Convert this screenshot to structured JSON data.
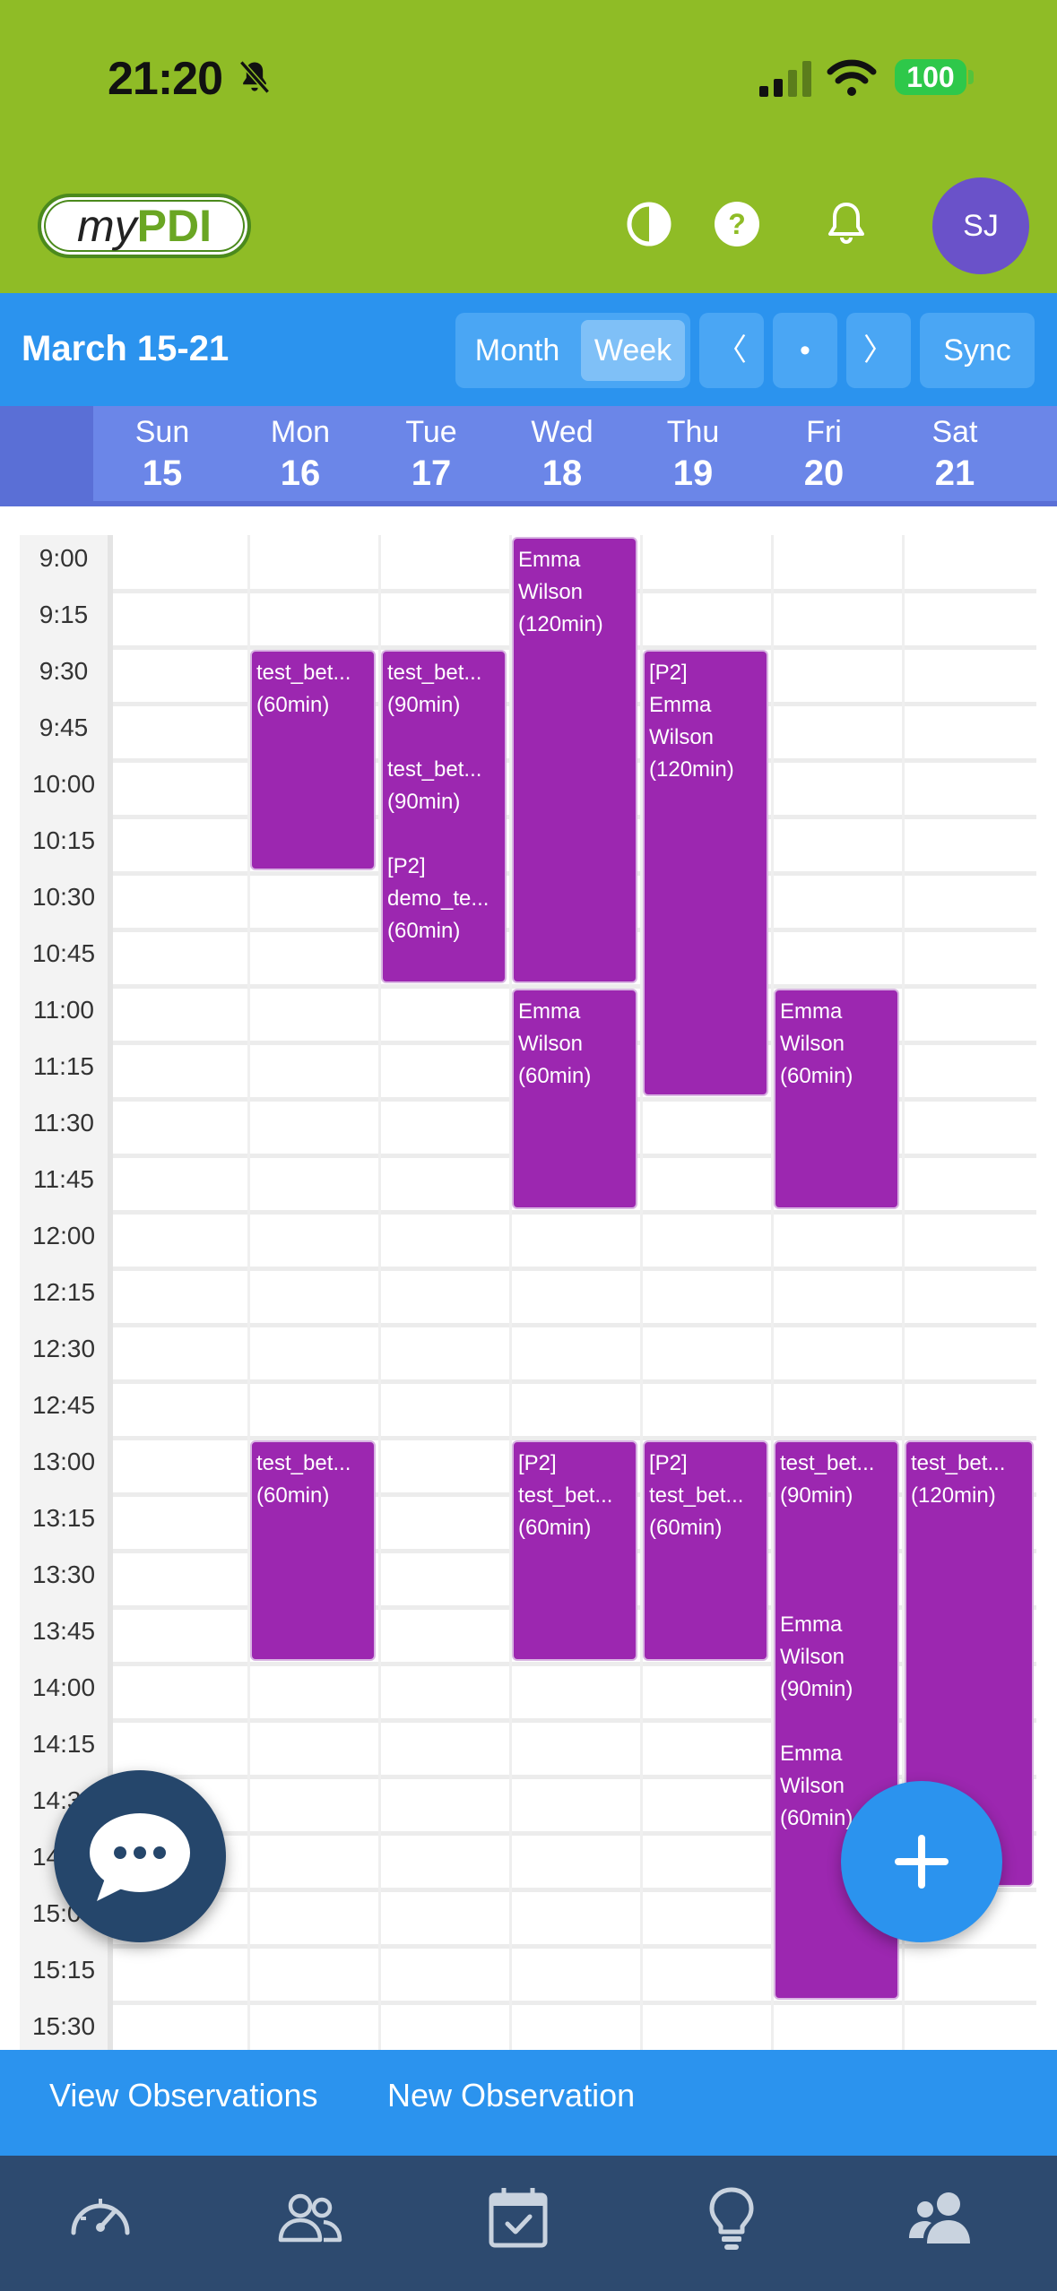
{
  "status_bar": {
    "time": "21:20",
    "battery": "100"
  },
  "header": {
    "logo_my": "my",
    "logo_pdi": "PDI",
    "avatar_initials": "SJ"
  },
  "calendar_bar": {
    "range_title": "March 15-21",
    "month_label": "Month",
    "week_label": "Week",
    "prev_label": "〈",
    "today_label": "•",
    "next_label": "〉",
    "sync_label": "Sync",
    "active_view": "Week"
  },
  "days": [
    {
      "name": "Sun",
      "num": "15"
    },
    {
      "name": "Mon",
      "num": "16"
    },
    {
      "name": "Tue",
      "num": "17"
    },
    {
      "name": "Wed",
      "num": "18"
    },
    {
      "name": "Thu",
      "num": "19"
    },
    {
      "name": "Fri",
      "num": "20"
    },
    {
      "name": "Sat",
      "num": "21"
    }
  ],
  "time_slots": [
    "9:00",
    "9:15",
    "9:30",
    "9:45",
    "10:00",
    "10:15",
    "10:30",
    "10:45",
    "11:00",
    "11:15",
    "11:30",
    "11:45",
    "12:00",
    "12:15",
    "12:30",
    "12:45",
    "13:00",
    "13:15",
    "13:30",
    "13:45",
    "14:00",
    "14:15",
    "14:30",
    "14:45",
    "15:00",
    "15:15",
    "15:30"
  ],
  "events": [
    {
      "day": 1,
      "start": "9:30",
      "duration_min": 60,
      "lines": [
        "test_bet...",
        "(60min)"
      ]
    },
    {
      "day": 2,
      "start": "9:30",
      "duration_min": 90,
      "lines": [
        "test_bet...",
        "(90min)",
        "",
        "test_bet...",
        "(90min)",
        "",
        "[P2]",
        "demo_te...",
        "(60min)"
      ]
    },
    {
      "day": 3,
      "start": "9:00",
      "duration_min": 120,
      "lines": [
        "Emma",
        "Wilson",
        "(120min)"
      ]
    },
    {
      "day": 4,
      "start": "9:30",
      "duration_min": 120,
      "lines": [
        "[P2]",
        "Emma",
        "Wilson",
        "(120min)"
      ]
    },
    {
      "day": 3,
      "start": "11:00",
      "duration_min": 60,
      "lines": [
        "Emma",
        "Wilson",
        "(60min)"
      ]
    },
    {
      "day": 5,
      "start": "11:00",
      "duration_min": 60,
      "lines": [
        "Emma",
        "Wilson",
        "(60min)"
      ]
    },
    {
      "day": 1,
      "start": "13:00",
      "duration_min": 60,
      "lines": [
        "test_bet...",
        "(60min)"
      ]
    },
    {
      "day": 3,
      "start": "13:00",
      "duration_min": 60,
      "lines": [
        "[P2]",
        "test_bet...",
        "(60min)"
      ]
    },
    {
      "day": 4,
      "start": "13:00",
      "duration_min": 60,
      "lines": [
        "[P2]",
        "test_bet...",
        "(60min)"
      ]
    },
    {
      "day": 5,
      "start": "13:00",
      "duration_min": 150,
      "lines": [
        "test_bet...",
        "(90min)",
        "",
        "",
        "",
        "Emma",
        "Wilson",
        "(90min)",
        "",
        "Emma",
        "Wilson",
        "(60min)"
      ]
    },
    {
      "day": 6,
      "start": "13:00",
      "duration_min": 120,
      "lines": [
        "test_bet...",
        "(120min)"
      ]
    }
  ],
  "actions": {
    "view_observations": "View Observations",
    "new_observation": "New Observation"
  },
  "tabs": [
    {
      "icon": "dashboard-gauge-icon"
    },
    {
      "icon": "people-outline-icon"
    },
    {
      "icon": "calendar-check-icon"
    },
    {
      "icon": "lightbulb-icon"
    },
    {
      "icon": "users-group-icon"
    }
  ],
  "colors": {
    "header_green": "#8fbc26",
    "primary_blue": "#2b93ee",
    "day_header": "#6b86e8",
    "event_purple": "#9c27b0",
    "tab_bar": "#2d4a6f",
    "avatar": "#6a52c9"
  }
}
